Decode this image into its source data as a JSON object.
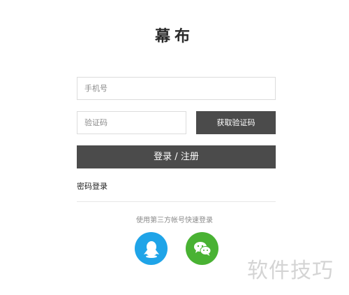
{
  "logo": {
    "text": "幕布"
  },
  "form": {
    "phone_placeholder": "手机号",
    "code_placeholder": "验证码",
    "get_code_label": "获取验证码",
    "login_label": "登录 / 注册",
    "password_login_label": "密码登录"
  },
  "third_party": {
    "label": "使用第三方帐号快速登录",
    "qq_color": "#1fa4e8",
    "wechat_color": "#49b233"
  },
  "watermark": {
    "text": "软件技巧"
  }
}
